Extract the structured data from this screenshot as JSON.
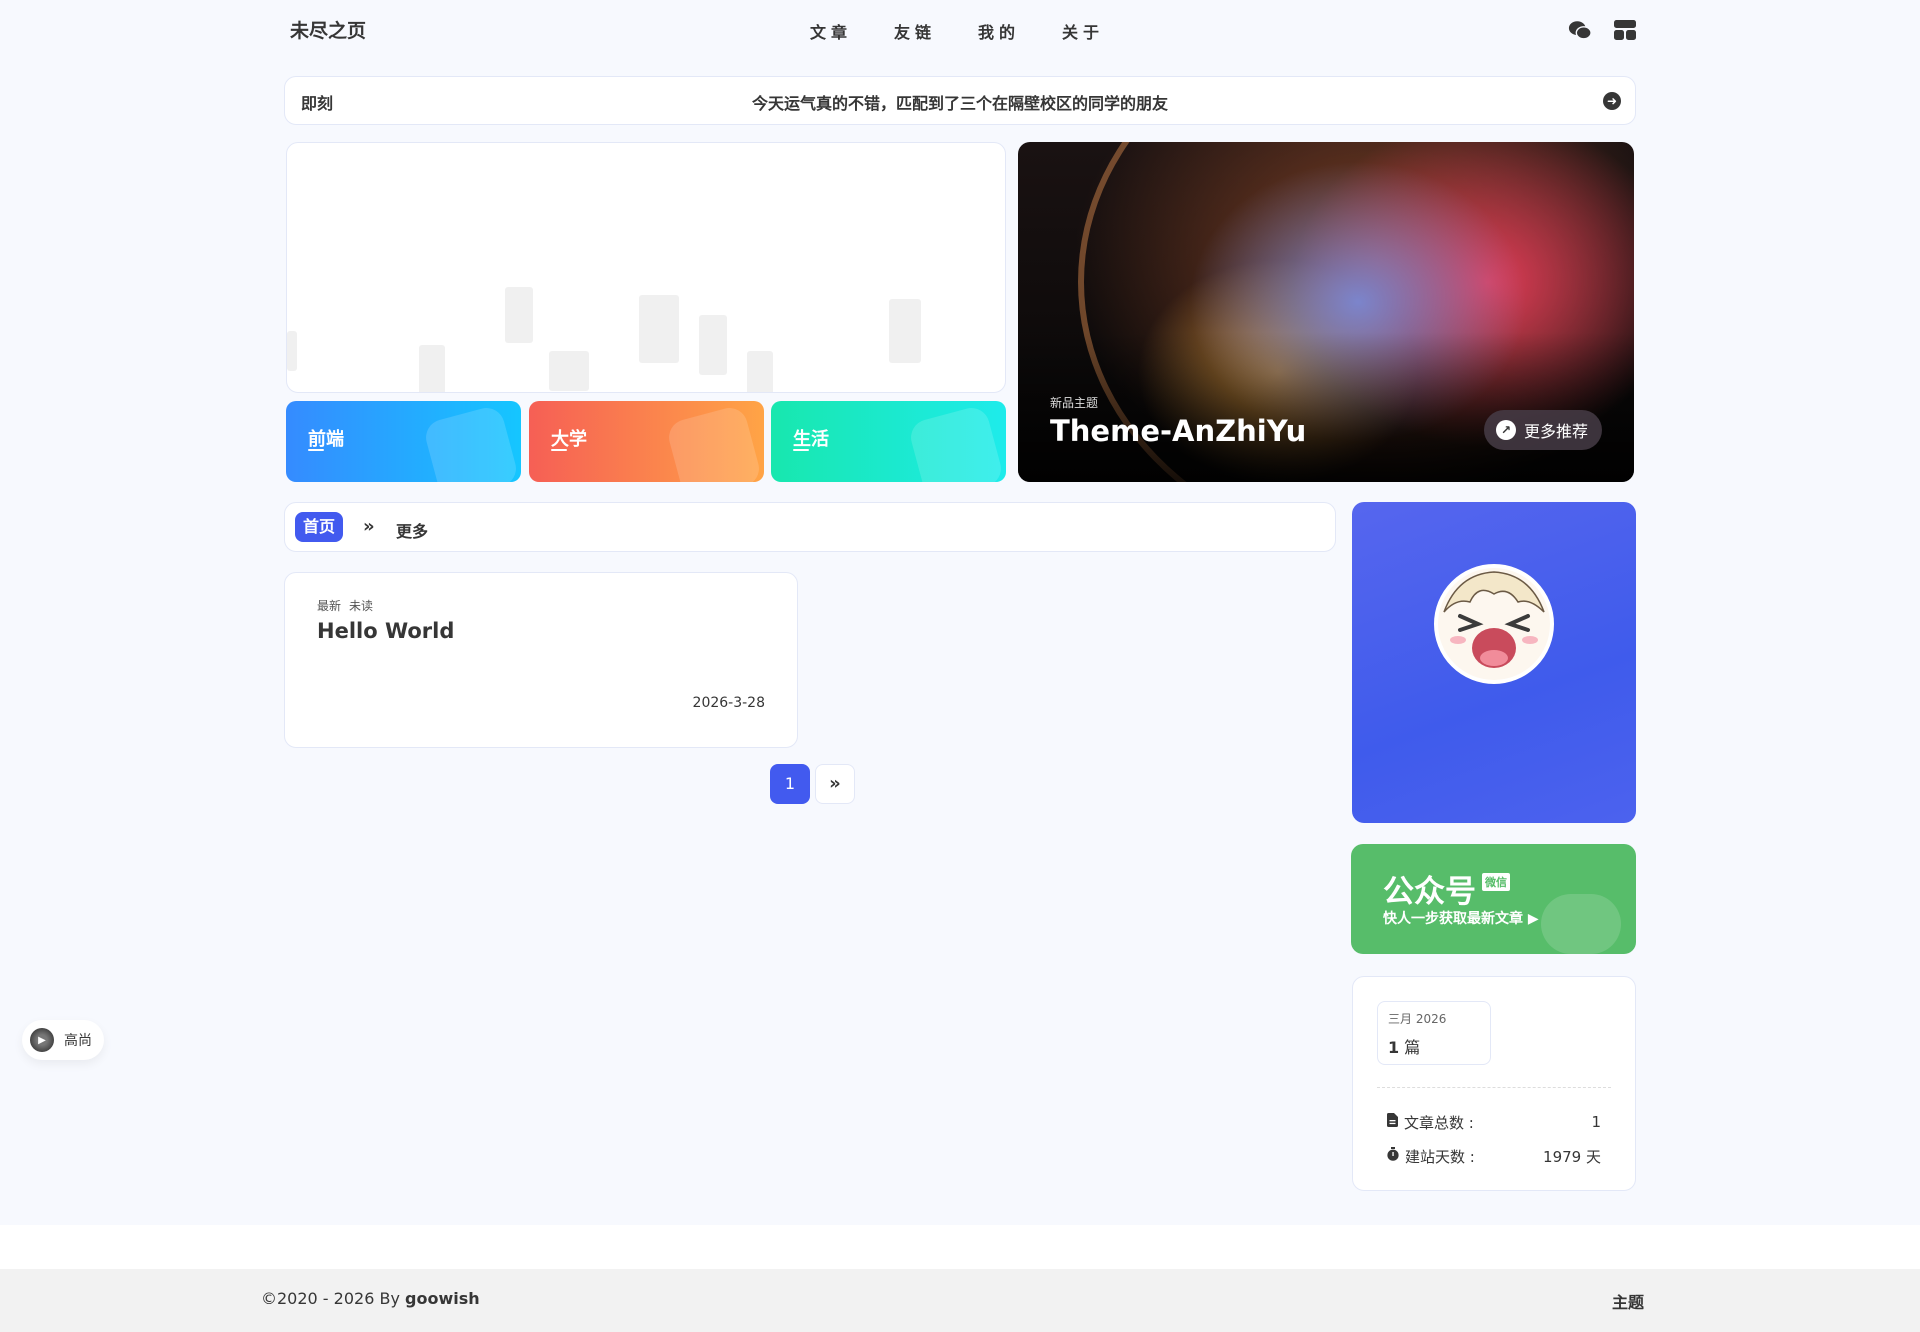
{
  "header": {
    "site_title": "未尽之页",
    "menu": [
      {
        "label": "文章"
      },
      {
        "label": "友链"
      },
      {
        "label": "我的"
      },
      {
        "label": "关于"
      }
    ],
    "icons": [
      "wechat-icon",
      "layout-icon"
    ]
  },
  "announcement": {
    "label": "即刻",
    "text": "今天运气真的不错，匹配到了三个在隔壁校区的同学的朋友"
  },
  "categories": [
    {
      "label": "前端",
      "color_from": "#358bff",
      "color_to": "#15c6ff"
    },
    {
      "label": "大学",
      "color_from": "#f65f55",
      "color_to": "#ffa446"
    },
    {
      "label": "生活",
      "color_from": "#18e7ae",
      "color_to": "#1eebeb"
    }
  ],
  "banner": {
    "tag": "新品主题",
    "title": "Theme-AnZhiYu",
    "button": "更多推荐"
  },
  "category_bar": {
    "home": "首页",
    "more": "更多"
  },
  "posts": [
    {
      "tags": [
        "最新",
        "未读"
      ],
      "title": "Hello World",
      "date": "2026-3-28"
    }
  ],
  "pagination": {
    "current": "1"
  },
  "wechat_card": {
    "title": "公众号",
    "badge": "微信",
    "subtitle": "快人一步获取最新文章 ▶"
  },
  "archive": {
    "month_label": "三月 2026",
    "month_count": "1",
    "month_unit": "篇",
    "stats": [
      {
        "label": "文章总数 :",
        "value": "1"
      },
      {
        "label": "建站天数 :",
        "value": "1979 天"
      }
    ]
  },
  "music": {
    "name": "高尚"
  },
  "footer": {
    "copyright_prefix": "©2020 - 2026 By ",
    "author": "goowish",
    "theme": "主题"
  },
  "colors": {
    "accent": "#425aef",
    "wechat_green": "#57bd6a",
    "background": "#f7f9fe"
  }
}
